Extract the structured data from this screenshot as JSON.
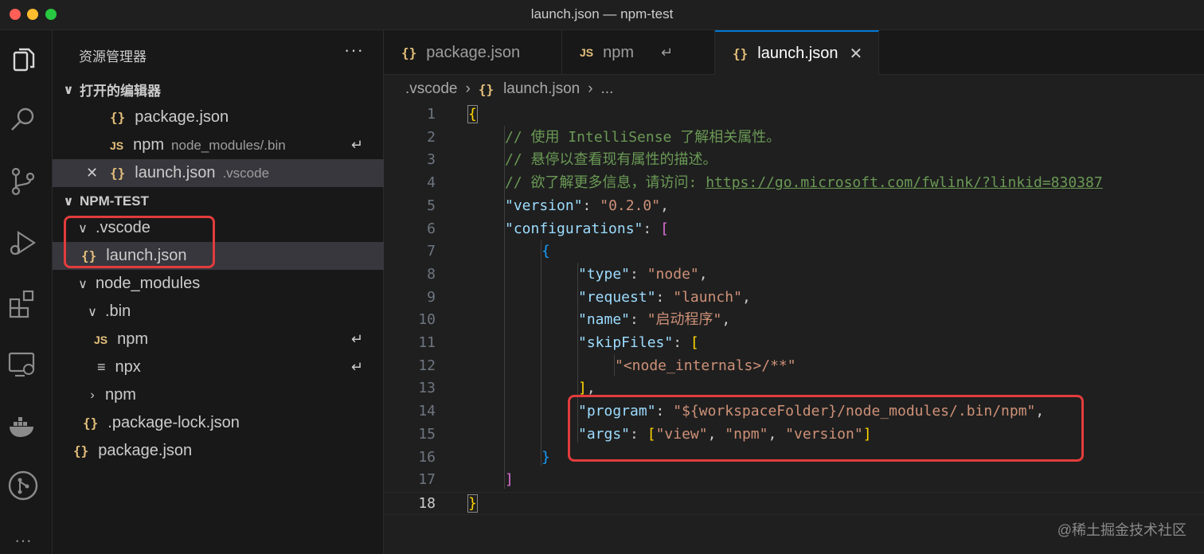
{
  "window": {
    "title": "launch.json — npm-test"
  },
  "activity": [
    "explorer-icon",
    "search-icon",
    "source-control-icon",
    "run-debug-icon",
    "extensions-icon",
    "remote-explorer-icon",
    "docker-icon",
    "git-graph-icon",
    "more-icon"
  ],
  "sidebar": {
    "header": "资源管理器",
    "more": "···",
    "open_editors": {
      "title": "打开的编辑器",
      "items": [
        {
          "icon": "{}",
          "name": "package.json",
          "sub": ""
        },
        {
          "icon": "JS",
          "name": "npm",
          "sub": "node_modules/.bin",
          "symlink": "↵"
        },
        {
          "icon": "{}",
          "name": "launch.json",
          "sub": ".vscode",
          "close": "✕"
        }
      ]
    },
    "project": {
      "title": "NPM-TEST",
      "tree": [
        {
          "name": ".vscode",
          "chev": "∨"
        },
        {
          "name": "launch.json",
          "icon": "{}"
        },
        {
          "name": "node_modules",
          "chev": "∨"
        },
        {
          "name": ".bin",
          "chev": "∨"
        },
        {
          "name": "npm",
          "icon": "JS",
          "symlink": "↵"
        },
        {
          "name": "npx",
          "icon": "≡",
          "symlink": "↵"
        },
        {
          "name": "npm",
          "chev": "›"
        },
        {
          "name": ".package-lock.json",
          "icon": "{}"
        },
        {
          "name": "package.json",
          "icon": "{}"
        }
      ]
    }
  },
  "tabs": [
    {
      "icon": "{}",
      "label": "package.json"
    },
    {
      "icon": "JS",
      "label": "npm",
      "symlink": "↵"
    },
    {
      "icon": "{}",
      "label": "launch.json",
      "close": "✕"
    }
  ],
  "breadcrumb": {
    "folder": ".vscode",
    "file": "launch.json",
    "rest": "...",
    "sep": "›",
    "icon": "{}"
  },
  "code": {
    "line_numbers": [
      "1",
      "2",
      "3",
      "4",
      "5",
      "6",
      "7",
      "8",
      "9",
      "10",
      "11",
      "12",
      "13",
      "14",
      "15",
      "16",
      "17",
      "18"
    ],
    "l1": "{",
    "l2": "// 使用 IntelliSense 了解相关属性。",
    "l3": "// 悬停以查看现有属性的描述。",
    "l4a": "// 欲了解更多信息，请访问: ",
    "l4b": "https://go.microsoft.com/fwlink/?linkid=830387",
    "version_key": "\"version\"",
    "version_val": "\"0.2.0\"",
    "config_key": "\"configurations\"",
    "type_key": "\"type\"",
    "type_val": "\"node\"",
    "request_key": "\"request\"",
    "request_val": "\"launch\"",
    "name_key": "\"name\"",
    "name_val": "\"启动程序\"",
    "skip_key": "\"skipFiles\"",
    "skip_val": "\"<node_internals>/**\"",
    "program_key": "\"program\"",
    "program_val": "\"${workspaceFolder}/node_modules/.bin/npm\"",
    "args_key": "\"args\"",
    "args_v1": "\"view\"",
    "args_v2": "\"npm\"",
    "args_v3": "\"version\""
  },
  "watermark": "@稀土掘金技术社区",
  "colors": {
    "accent": "#0078d4",
    "highlight": "#e23c3c",
    "json_icon": "#e5c07b"
  }
}
